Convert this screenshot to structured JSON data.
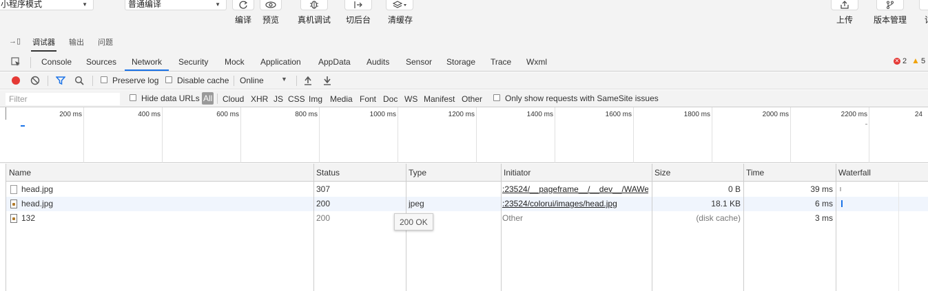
{
  "toolbar": {
    "mode_select": "小程序模式",
    "compile_select": "普通编译",
    "buttons": {
      "compile": "编译",
      "preview": "预览",
      "remote_debug": "真机调试",
      "background": "切后台",
      "clear_cache": "清缓存",
      "upload": "上传",
      "version": "版本管理",
      "detail": "详"
    }
  },
  "panel_tabs": [
    "调试器",
    "输出",
    "问题"
  ],
  "devtools_tabs": [
    "Console",
    "Sources",
    "Network",
    "Security",
    "Mock",
    "Application",
    "AppData",
    "Audits",
    "Sensor",
    "Storage",
    "Trace",
    "Wxml"
  ],
  "badges": {
    "errors": "2",
    "warnings": "5",
    "error_color": "#e53935",
    "warning_color": "#f0a30a"
  },
  "net_toolbar": {
    "preserve_log": "Preserve log",
    "disable_cache": "Disable cache",
    "throttle": "Online",
    "record_color": "#e53935",
    "filter_active_color": "#1a73e8"
  },
  "filter_bar": {
    "placeholder": "Filter",
    "hide_data_urls": "Hide data URLs",
    "types": [
      "All",
      "Cloud",
      "XHR",
      "JS",
      "CSS",
      "Img",
      "Media",
      "Font",
      "Doc",
      "WS",
      "Manifest",
      "Other"
    ],
    "samesite": "Only show requests with SameSite issues"
  },
  "overview": {
    "ticks": [
      "200 ms",
      "400 ms",
      "600 ms",
      "800 ms",
      "1000 ms",
      "1200 ms",
      "1400 ms",
      "1600 ms",
      "1800 ms",
      "2000 ms",
      "2200 ms",
      "24"
    ]
  },
  "table": {
    "headers": {
      "name": "Name",
      "status": "Status",
      "type": "Type",
      "initiator": "Initiator",
      "size": "Size",
      "time": "Time",
      "waterfall": "Waterfall"
    },
    "rows": [
      {
        "name": "head.jpg",
        "status": "307",
        "type": "",
        "initiator": ":23524/__pageframe__/__dev__/WAWe...",
        "size": "0 B",
        "time": "39 ms"
      },
      {
        "name": "head.jpg",
        "status": "200",
        "type": "jpeg",
        "initiator": ":23524/colorui/images/head.jpg",
        "size": "18.1 KB",
        "time": "6 ms"
      },
      {
        "name": "132",
        "status": "200",
        "type": "",
        "initiator": "Other",
        "size": "(disk cache)",
        "time": "3 ms"
      }
    ],
    "tooltip": "200 OK"
  }
}
